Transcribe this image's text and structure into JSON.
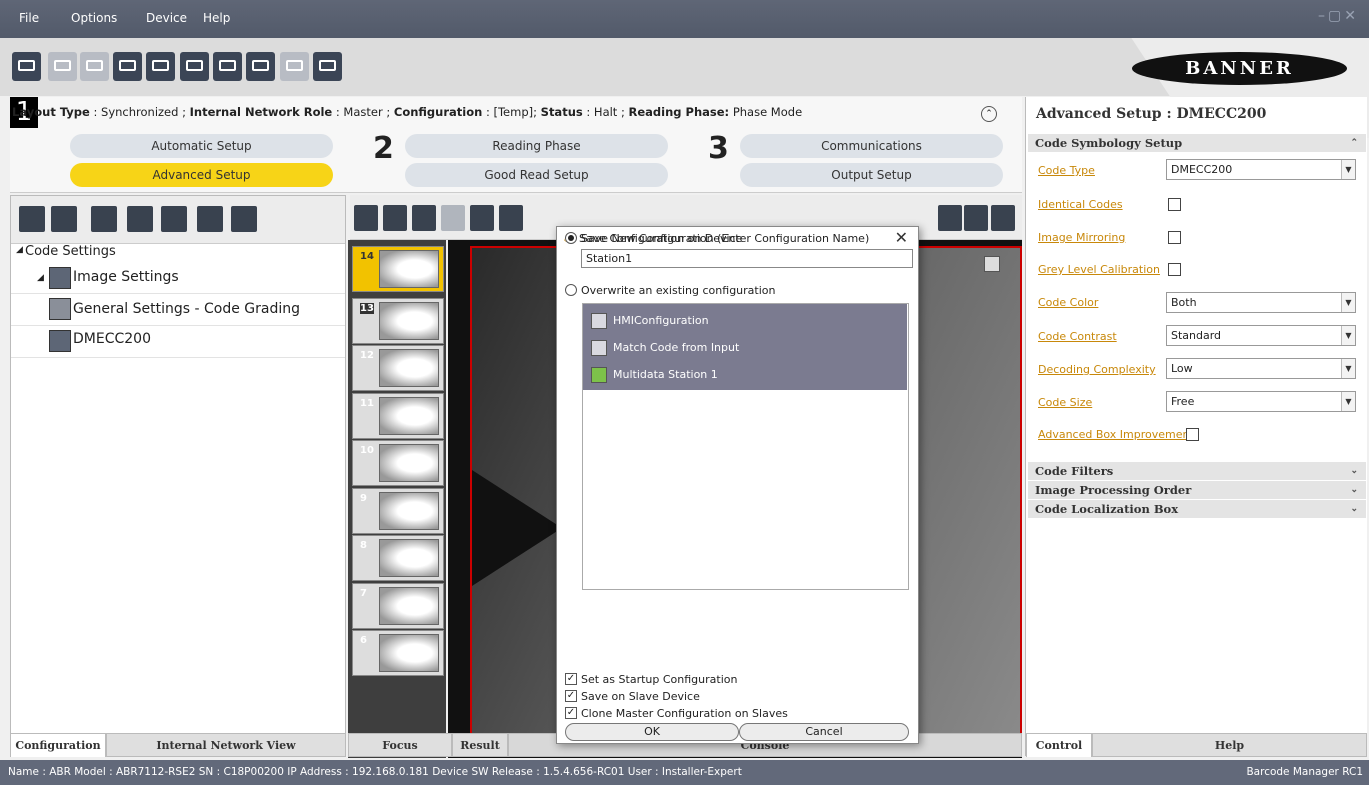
{
  "menu": {
    "items": [
      "File",
      "Options",
      "Device",
      "Help"
    ]
  },
  "logo": {
    "text": "BANNER"
  },
  "phase_bar": {
    "layout_type_label": "Layout Type",
    "layout_type": "Synchronized",
    "network_role_label": "Internal Network Role",
    "network_role": "Master",
    "configuration_label": "Configuration",
    "configuration": "[Temp]",
    "status_label": "Status",
    "status": "Halt",
    "reading_phase_label": "Reading Phase:",
    "reading_phase": "Phase Mode",
    "steps": [
      {
        "number": "1",
        "top": "Automatic Setup",
        "bottom": "Advanced Setup"
      },
      {
        "number": "2",
        "top": "Reading Phase",
        "bottom": "Good Read Setup"
      },
      {
        "number": "3",
        "top": "Communications",
        "bottom": "Output Setup"
      }
    ]
  },
  "tree": {
    "root": "Code Settings",
    "items": [
      "Image Settings",
      "General Settings - Code Grading",
      "DMECC200"
    ]
  },
  "left_tabs": [
    "Configuration",
    "Internal Network View"
  ],
  "thumbnails": [
    "14",
    "13",
    "12",
    "11",
    "10",
    "9",
    "8",
    "7",
    "6"
  ],
  "mid_tabs": [
    "Focus Calibration",
    "Result",
    "Console"
  ],
  "right_panel": {
    "title": "Advanced Setup : DMECC200",
    "section_main": "Code Symbology Setup",
    "props": {
      "code_type_label": "Code Type",
      "code_type_value": "DMECC200",
      "identical_codes_label": "Identical Codes",
      "image_mirroring_label": "Image Mirroring",
      "grey_level_label": "Grey Level Calibration",
      "code_color_label": "Code Color",
      "code_color_value": "Both",
      "code_contrast_label": "Code Contrast",
      "code_contrast_value": "Standard",
      "decoding_complexity_label": "Decoding Complexity",
      "decoding_complexity_value": "Low",
      "code_size_label": "Code Size",
      "code_size_value": "Free",
      "advanced_box_label": "Advanced Box Improvement"
    },
    "sections": [
      "Code Filters",
      "Image Processing Order",
      "Code Localization Box"
    ],
    "tabs": [
      "Control",
      "Help"
    ]
  },
  "dialog": {
    "title": "Save Configuration on Device",
    "option_new": "Save New Configuration (Enter Configuration Name)",
    "name_value": "Station1",
    "option_overwrite": "Overwrite an existing configuration",
    "configs": [
      "HMIConfiguration",
      "Match Code from Input",
      "Multidata Station 1"
    ],
    "check_startup": "Set as Startup Configuration",
    "check_slave": "Save on Slave Device",
    "check_clone": "Clone Master Configuration on Slaves",
    "ok": "OK",
    "cancel": "Cancel"
  },
  "status_bar": {
    "left": "Name : ABR  Model : ABR7112-RSE2  SN : C18P00200  IP Address : 192.168.0.181  Device SW Release : 1.5.4.656-RC01  User : Installer-Expert",
    "right": "Barcode Manager RC1"
  }
}
